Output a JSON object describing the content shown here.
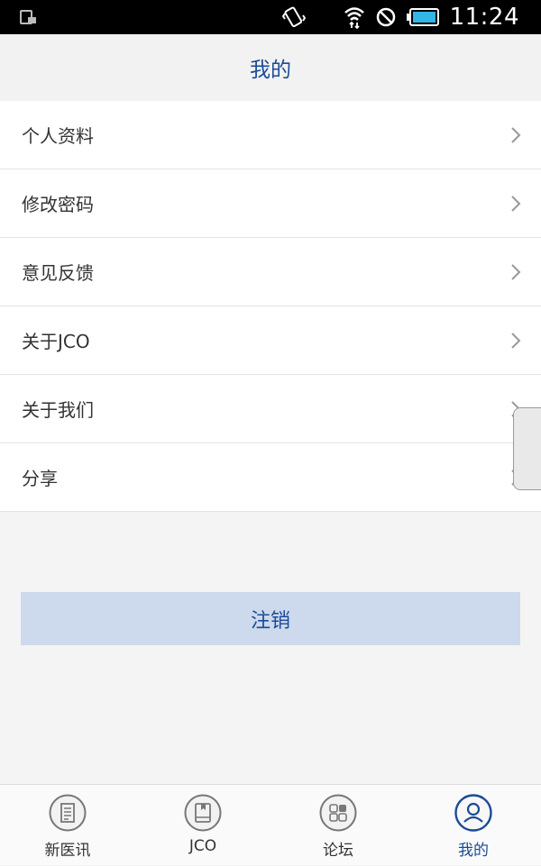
{
  "status_bar": {
    "time": "11:24"
  },
  "header": {
    "title": "我的"
  },
  "menu": {
    "items": [
      {
        "label": "个人资料"
      },
      {
        "label": "修改密码"
      },
      {
        "label": "意见反馈"
      },
      {
        "label": "关于JCO"
      },
      {
        "label": "关于我们"
      },
      {
        "label": "分享"
      }
    ]
  },
  "logout": {
    "label": "注销"
  },
  "bottom_nav": {
    "tabs": [
      {
        "label": "新医讯",
        "icon": "news-icon",
        "active": false
      },
      {
        "label": "JCO",
        "icon": "book-icon",
        "active": false
      },
      {
        "label": "论坛",
        "icon": "grid-apps-icon",
        "active": false
      },
      {
        "label": "我的",
        "icon": "user-profile-icon",
        "active": true
      }
    ]
  },
  "colors": {
    "accent": "#1b4a96",
    "logout_bg": "#cdd9ec",
    "header_bg": "#f2f2f2",
    "page_bg": "#f4f4f4"
  }
}
